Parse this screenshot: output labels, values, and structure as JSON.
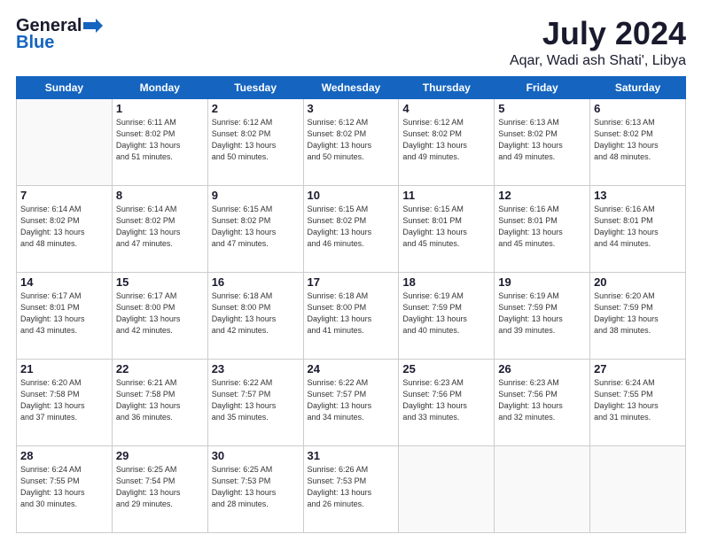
{
  "header": {
    "logo_general": "General",
    "logo_blue": "Blue",
    "title": "July 2024",
    "subtitle": "Aqar, Wadi ash Shati', Libya"
  },
  "weekdays": [
    "Sunday",
    "Monday",
    "Tuesday",
    "Wednesday",
    "Thursday",
    "Friday",
    "Saturday"
  ],
  "weeks": [
    [
      {
        "day": "",
        "info": ""
      },
      {
        "day": "1",
        "info": "Sunrise: 6:11 AM\nSunset: 8:02 PM\nDaylight: 13 hours\nand 51 minutes."
      },
      {
        "day": "2",
        "info": "Sunrise: 6:12 AM\nSunset: 8:02 PM\nDaylight: 13 hours\nand 50 minutes."
      },
      {
        "day": "3",
        "info": "Sunrise: 6:12 AM\nSunset: 8:02 PM\nDaylight: 13 hours\nand 50 minutes."
      },
      {
        "day": "4",
        "info": "Sunrise: 6:12 AM\nSunset: 8:02 PM\nDaylight: 13 hours\nand 49 minutes."
      },
      {
        "day": "5",
        "info": "Sunrise: 6:13 AM\nSunset: 8:02 PM\nDaylight: 13 hours\nand 49 minutes."
      },
      {
        "day": "6",
        "info": "Sunrise: 6:13 AM\nSunset: 8:02 PM\nDaylight: 13 hours\nand 48 minutes."
      }
    ],
    [
      {
        "day": "7",
        "info": "Sunrise: 6:14 AM\nSunset: 8:02 PM\nDaylight: 13 hours\nand 48 minutes."
      },
      {
        "day": "8",
        "info": "Sunrise: 6:14 AM\nSunset: 8:02 PM\nDaylight: 13 hours\nand 47 minutes."
      },
      {
        "day": "9",
        "info": "Sunrise: 6:15 AM\nSunset: 8:02 PM\nDaylight: 13 hours\nand 47 minutes."
      },
      {
        "day": "10",
        "info": "Sunrise: 6:15 AM\nSunset: 8:02 PM\nDaylight: 13 hours\nand 46 minutes."
      },
      {
        "day": "11",
        "info": "Sunrise: 6:15 AM\nSunset: 8:01 PM\nDaylight: 13 hours\nand 45 minutes."
      },
      {
        "day": "12",
        "info": "Sunrise: 6:16 AM\nSunset: 8:01 PM\nDaylight: 13 hours\nand 45 minutes."
      },
      {
        "day": "13",
        "info": "Sunrise: 6:16 AM\nSunset: 8:01 PM\nDaylight: 13 hours\nand 44 minutes."
      }
    ],
    [
      {
        "day": "14",
        "info": "Sunrise: 6:17 AM\nSunset: 8:01 PM\nDaylight: 13 hours\nand 43 minutes."
      },
      {
        "day": "15",
        "info": "Sunrise: 6:17 AM\nSunset: 8:00 PM\nDaylight: 13 hours\nand 42 minutes."
      },
      {
        "day": "16",
        "info": "Sunrise: 6:18 AM\nSunset: 8:00 PM\nDaylight: 13 hours\nand 42 minutes."
      },
      {
        "day": "17",
        "info": "Sunrise: 6:18 AM\nSunset: 8:00 PM\nDaylight: 13 hours\nand 41 minutes."
      },
      {
        "day": "18",
        "info": "Sunrise: 6:19 AM\nSunset: 7:59 PM\nDaylight: 13 hours\nand 40 minutes."
      },
      {
        "day": "19",
        "info": "Sunrise: 6:19 AM\nSunset: 7:59 PM\nDaylight: 13 hours\nand 39 minutes."
      },
      {
        "day": "20",
        "info": "Sunrise: 6:20 AM\nSunset: 7:59 PM\nDaylight: 13 hours\nand 38 minutes."
      }
    ],
    [
      {
        "day": "21",
        "info": "Sunrise: 6:20 AM\nSunset: 7:58 PM\nDaylight: 13 hours\nand 37 minutes."
      },
      {
        "day": "22",
        "info": "Sunrise: 6:21 AM\nSunset: 7:58 PM\nDaylight: 13 hours\nand 36 minutes."
      },
      {
        "day": "23",
        "info": "Sunrise: 6:22 AM\nSunset: 7:57 PM\nDaylight: 13 hours\nand 35 minutes."
      },
      {
        "day": "24",
        "info": "Sunrise: 6:22 AM\nSunset: 7:57 PM\nDaylight: 13 hours\nand 34 minutes."
      },
      {
        "day": "25",
        "info": "Sunrise: 6:23 AM\nSunset: 7:56 PM\nDaylight: 13 hours\nand 33 minutes."
      },
      {
        "day": "26",
        "info": "Sunrise: 6:23 AM\nSunset: 7:56 PM\nDaylight: 13 hours\nand 32 minutes."
      },
      {
        "day": "27",
        "info": "Sunrise: 6:24 AM\nSunset: 7:55 PM\nDaylight: 13 hours\nand 31 minutes."
      }
    ],
    [
      {
        "day": "28",
        "info": "Sunrise: 6:24 AM\nSunset: 7:55 PM\nDaylight: 13 hours\nand 30 minutes."
      },
      {
        "day": "29",
        "info": "Sunrise: 6:25 AM\nSunset: 7:54 PM\nDaylight: 13 hours\nand 29 minutes."
      },
      {
        "day": "30",
        "info": "Sunrise: 6:25 AM\nSunset: 7:53 PM\nDaylight: 13 hours\nand 28 minutes."
      },
      {
        "day": "31",
        "info": "Sunrise: 6:26 AM\nSunset: 7:53 PM\nDaylight: 13 hours\nand 26 minutes."
      },
      {
        "day": "",
        "info": ""
      },
      {
        "day": "",
        "info": ""
      },
      {
        "day": "",
        "info": ""
      }
    ]
  ]
}
